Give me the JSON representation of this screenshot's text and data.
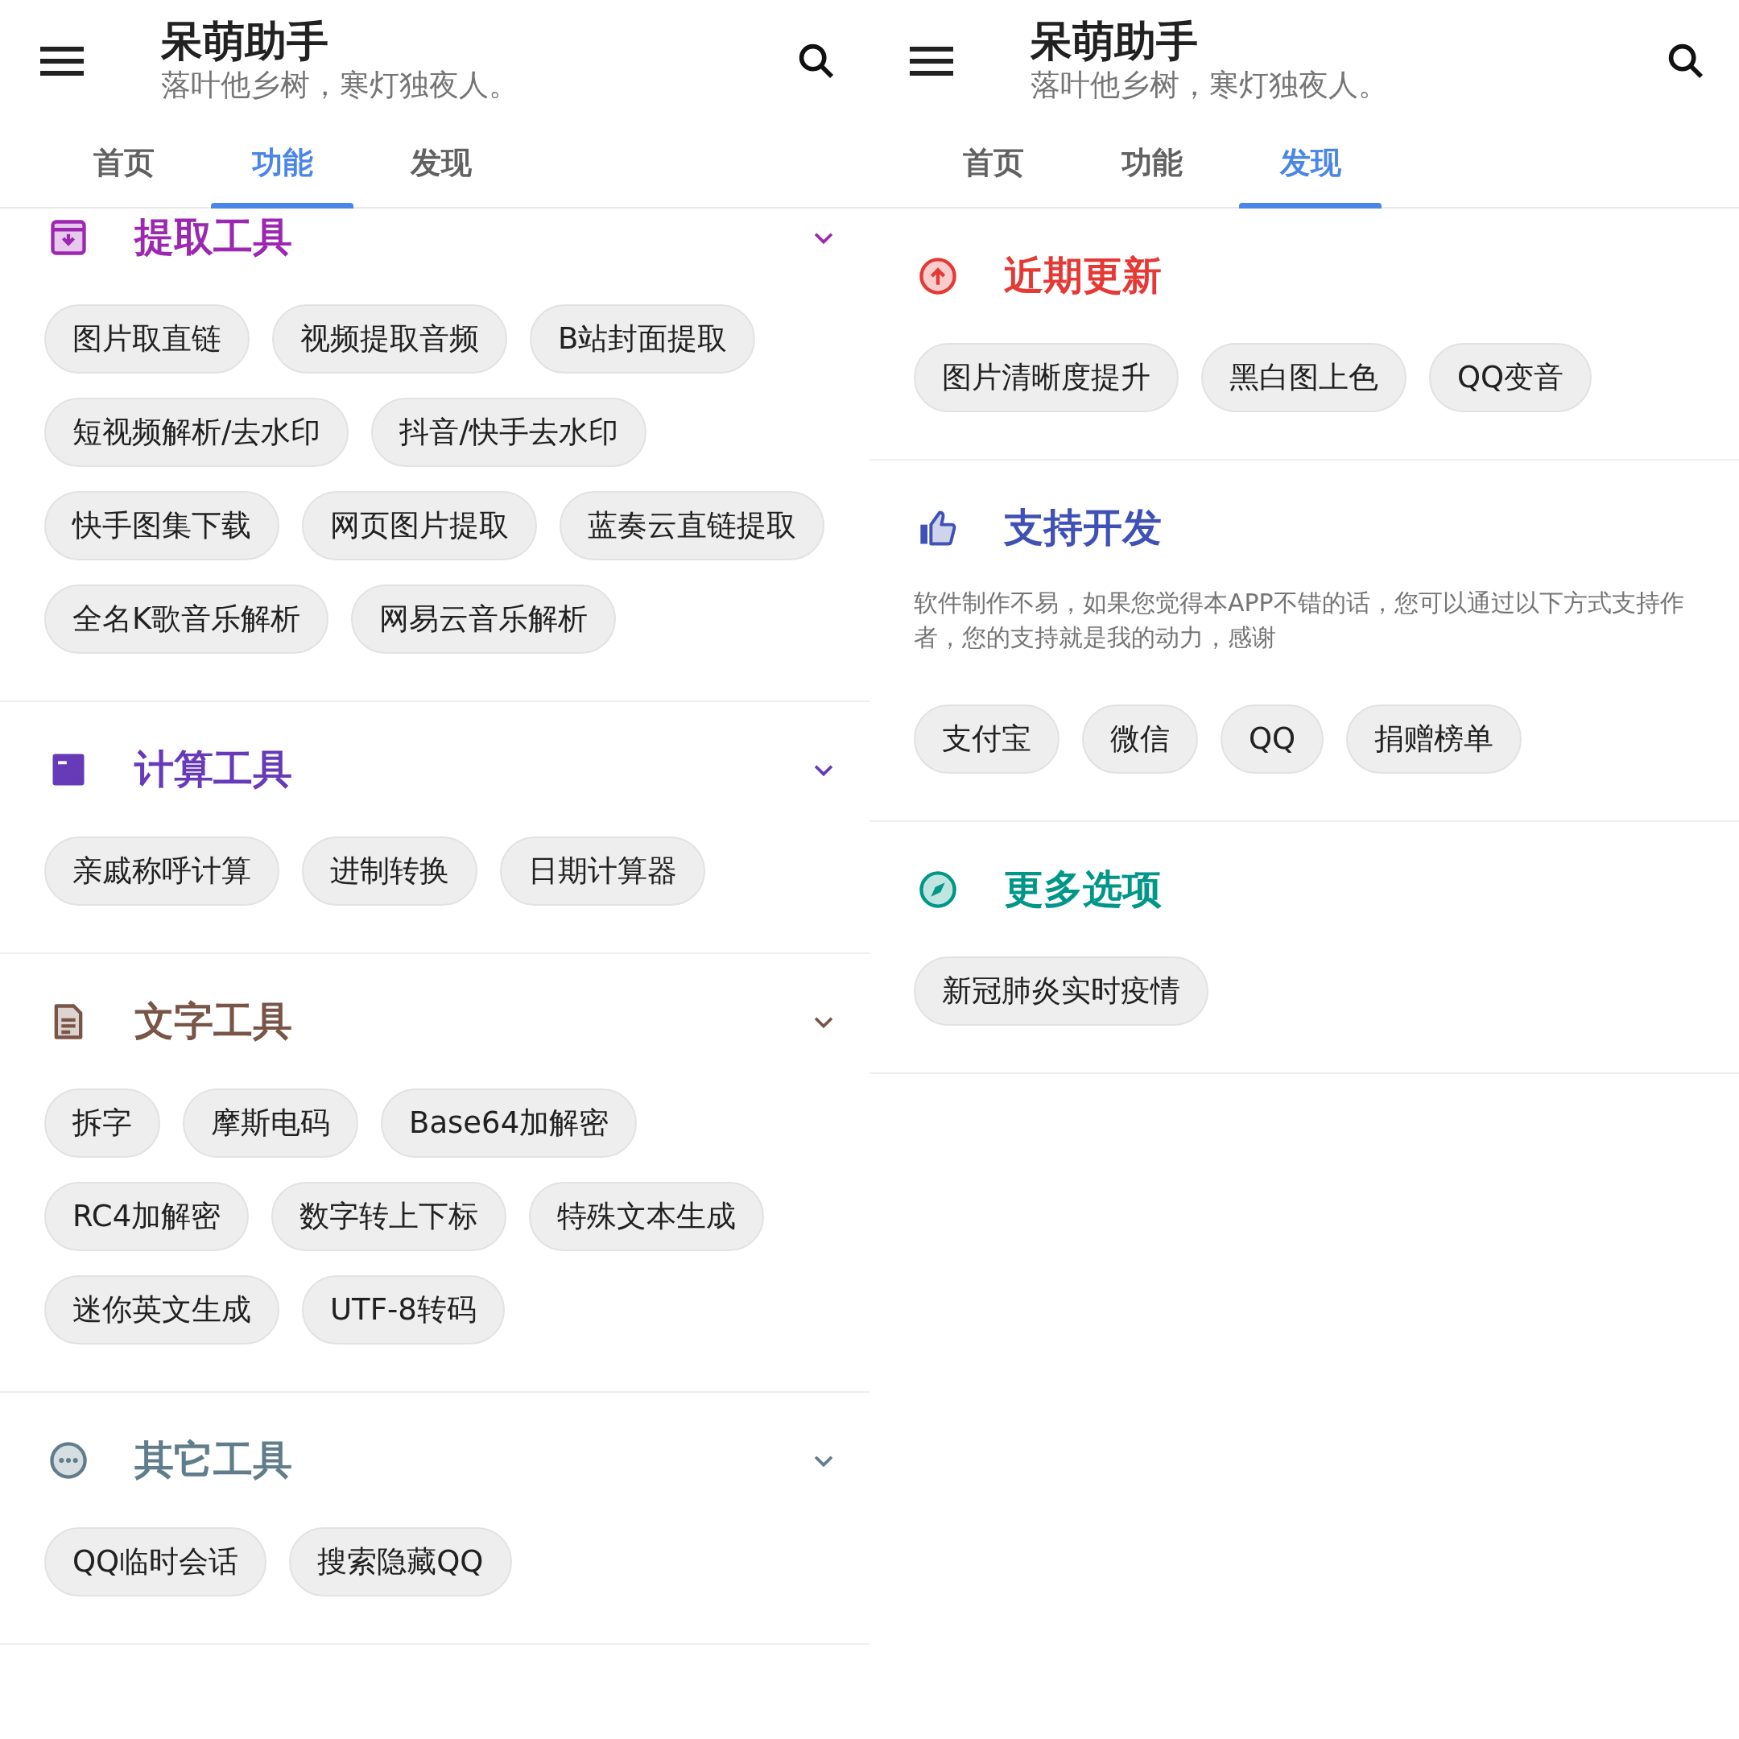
{
  "panels": [
    {
      "app_bar": {
        "title": "呆萌助手",
        "subtitle": "落叶他乡树，寒灯独夜人。"
      },
      "tabs": [
        {
          "label": "首页",
          "selected": false
        },
        {
          "label": "功能",
          "selected": true
        },
        {
          "label": "发现",
          "selected": false
        }
      ],
      "sections": [
        {
          "kind": "extract",
          "title": "提取工具",
          "color": "#9c27b0",
          "expanded": true,
          "chips": [
            "图片取直链",
            "视频提取音频",
            "B站封面提取",
            "短视频解析/去水印",
            "抖音/快手去水印",
            "快手图集下载",
            "网页图片提取",
            "蓝奏云直链提取",
            "全名K歌音乐解析",
            "网易云音乐解析"
          ]
        },
        {
          "kind": "calculate",
          "title": "计算工具",
          "color": "#673ab7",
          "expanded": true,
          "chips": [
            "亲戚称呼计算",
            "进制转换",
            "日期计算器"
          ]
        },
        {
          "kind": "text",
          "title": "文字工具",
          "color": "#795548",
          "expanded": true,
          "chips": [
            "拆字",
            "摩斯电码",
            "Base64加解密",
            "RC4加解密",
            "数字转上下标",
            "特殊文本生成",
            "迷你英文生成",
            "UTF-8转码"
          ]
        },
        {
          "kind": "other",
          "title": "其它工具",
          "color": "#607d8b",
          "expanded": true,
          "chips": [
            "QQ临时会话",
            "搜索隐藏QQ"
          ]
        }
      ]
    },
    {
      "app_bar": {
        "title": "呆萌助手",
        "subtitle": "落叶他乡树，寒灯独夜人。"
      },
      "tabs": [
        {
          "label": "首页",
          "selected": false
        },
        {
          "label": "功能",
          "selected": false
        },
        {
          "label": "发现",
          "selected": true
        }
      ],
      "sections": [
        {
          "kind": "updates",
          "title": "近期更新",
          "color": "#e53935",
          "chips": [
            "图片清晰度提升",
            "黑白图上色",
            "QQ变音"
          ]
        },
        {
          "kind": "support",
          "title": "支持开发",
          "color": "#3f51b5",
          "description": "软件制作不易，如果您觉得本APP不错的话，您可以通过以下方式支持作者，您的支持就是我的动力，感谢",
          "chips": [
            "支付宝",
            "微信",
            "QQ",
            "捐赠榜单"
          ]
        },
        {
          "kind": "more",
          "title": "更多选项",
          "color": "#009688",
          "chips": [
            "新冠肺炎实时疫情"
          ]
        }
      ]
    }
  ]
}
